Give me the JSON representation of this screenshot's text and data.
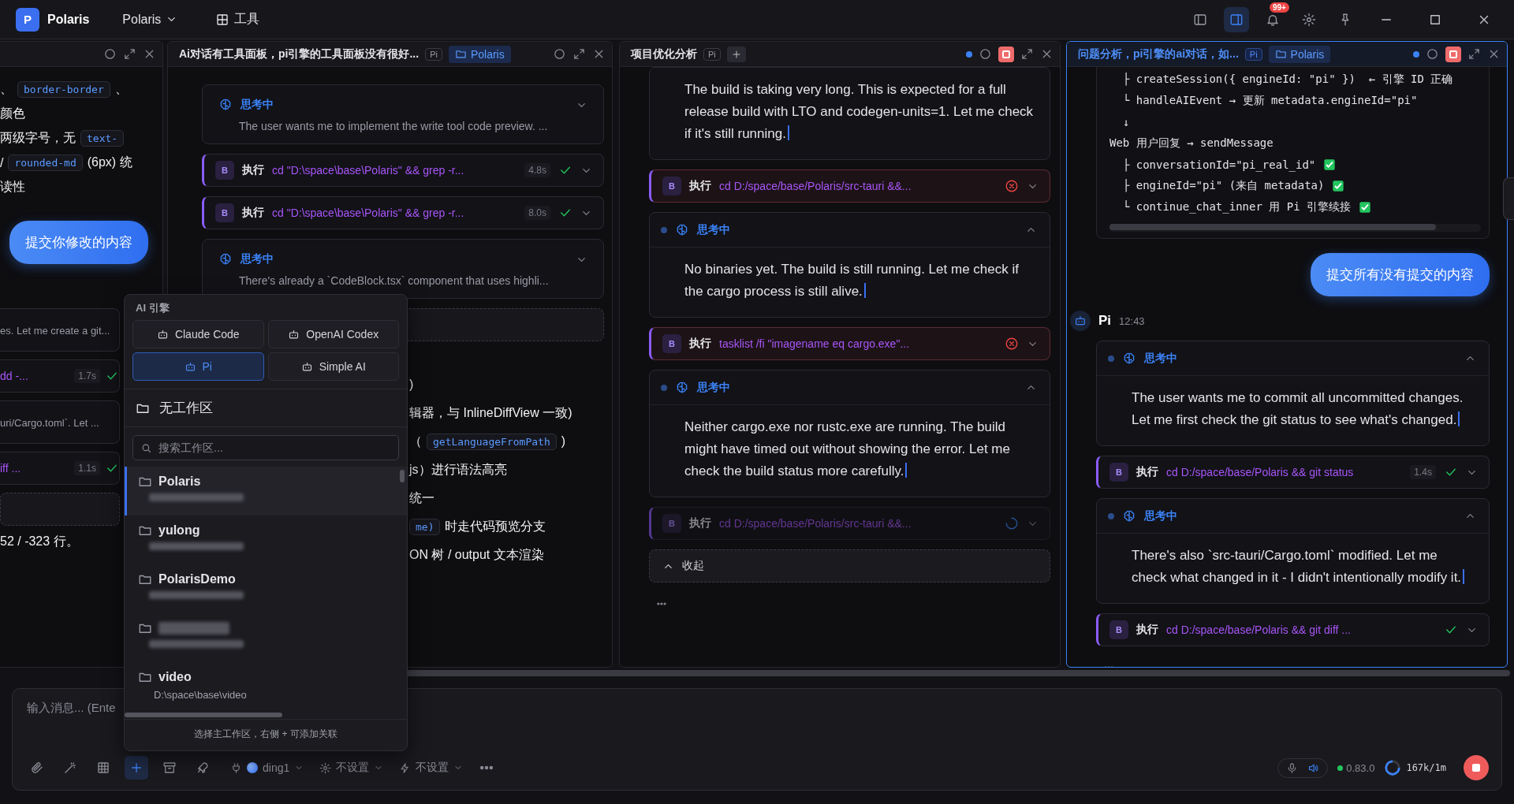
{
  "titlebar": {
    "logo": "P",
    "app_name": "Polaris",
    "project": "Polaris",
    "tools_label": "工具",
    "notification_badge": "99+",
    "layout_toggles": [
      {
        "kind": "left-sidebar",
        "on": false
      },
      {
        "kind": "right-sidebar",
        "on": true
      }
    ]
  },
  "panels": [
    {
      "header": {
        "active": false,
        "running": false
      },
      "blocks": [
        {
          "kind": "text",
          "segments": [
            {
              "kind": "plain",
              "text": "、"
            },
            {
              "kind": "code",
              "text": "border-border"
            },
            {
              "kind": "plain",
              "text": "、"
            }
          ]
        },
        {
          "kind": "text",
          "segments": [
            {
              "kind": "plain",
              "text": "颜色"
            }
          ]
        },
        {
          "kind": "text",
          "segments": [
            {
              "kind": "plain",
              "text": "两级字号，无"
            },
            {
              "kind": "code",
              "text": "text-"
            }
          ]
        },
        {
          "kind": "text",
          "segments": [
            {
              "kind": "plain",
              "text": "/"
            },
            {
              "kind": "code",
              "text": "rounded-md"
            },
            {
              "kind": "plain",
              "text": "(6px) 统"
            }
          ]
        },
        {
          "kind": "text",
          "segments": [
            {
              "kind": "plain",
              "text": "读性"
            }
          ]
        },
        {
          "kind": "user-message",
          "text": "提交你修改的内容"
        },
        {
          "kind": "thinking",
          "text": "es. Let me create a git...",
          "expanded": false,
          "live": false
        },
        {
          "kind": "exec",
          "command": "dd -...",
          "duration": "1.7s",
          "failed": false,
          "running": false
        },
        {
          "kind": "thinking",
          "text": "uri/Cargo.toml`. Let ...",
          "expanded": false,
          "live": false
        },
        {
          "kind": "exec",
          "command": "iff ...",
          "duration": "1.1s",
          "failed": false,
          "running": false
        },
        {
          "kind": "placeholder"
        },
        {
          "kind": "text",
          "segments": [
            {
              "kind": "plain",
              "text": "52 / -323 行。"
            }
          ]
        }
      ]
    },
    {
      "header": {
        "title": "Ai对话有工具面板，pi引擎的工具面板没有很好...",
        "badge": "Pi",
        "chip": "Polaris",
        "active": false,
        "running": false
      },
      "blocks": [
        {
          "kind": "thinking",
          "label": "思考中",
          "text": "The user wants me to implement the write tool code preview. ...",
          "expanded": false,
          "live": false
        },
        {
          "kind": "exec",
          "badge": "B",
          "label": "执行",
          "command": "cd \"D:\\space\\base\\Polaris\" && grep -r...",
          "duration": "4.8s",
          "failed": false,
          "running": false
        },
        {
          "kind": "exec",
          "badge": "B",
          "label": "执行",
          "command": "cd \"D:\\space\\base\\Polaris\" && grep -r...",
          "duration": "8.0s",
          "failed": false,
          "running": false
        },
        {
          "kind": "thinking",
          "label": "思考中",
          "text": "There's already a `CodeBlock.tsx` component that uses highli...",
          "expanded": false,
          "live": false
        },
        {
          "kind": "placeholder"
        },
        {
          "kind": "tail-text",
          "segments": [
            {
              "kind": "plain",
              "text": ")"
            }
          ]
        },
        {
          "kind": "tail-text",
          "segments": [
            {
              "kind": "plain",
              "text": "辑器，与 InlineDiffView 一致)"
            }
          ]
        },
        {
          "kind": "tail-text",
          "segments": [
            {
              "kind": "plain",
              "text": "（"
            },
            {
              "kind": "code",
              "text": "getLanguageFromPath"
            },
            {
              "kind": "plain",
              "text": ")"
            }
          ]
        },
        {
          "kind": "tail-text",
          "segments": [
            {
              "kind": "plain",
              "text": "js）进行语法高亮"
            }
          ]
        },
        {
          "kind": "tail-text",
          "segments": [
            {
              "kind": "plain",
              "text": "统一"
            }
          ]
        },
        {
          "kind": "tail-text",
          "segments": [
            {
              "kind": "code",
              "text": "me)"
            },
            {
              "kind": "plain",
              "text": "时走代码预览分支"
            }
          ]
        },
        {
          "kind": "tail-text",
          "segments": [
            {
              "kind": "plain",
              "text": "ON 树 / output 文本渲染"
            }
          ]
        }
      ]
    },
    {
      "header": {
        "title": "项目优化分析",
        "badge": "Pi",
        "can_add": true,
        "active": false,
        "running": true
      },
      "blocks": [
        {
          "kind": "thinking",
          "text": "The build is taking very long. This is expected for a full release build with LTO and codegen-units=1. Let me check if it's still running.",
          "expanded": true,
          "live": true
        },
        {
          "kind": "exec",
          "badge": "B",
          "label": "执行",
          "command": "cd D:/space/base/Polaris/src-tauri &&...",
          "failed": true,
          "running": false
        },
        {
          "kind": "thinking",
          "label": "思考中",
          "text": "No binaries yet. The build is still running. Let me check if the cargo process is still alive.",
          "expanded": true,
          "live": true
        },
        {
          "kind": "exec",
          "badge": "B",
          "label": "执行",
          "command": "tasklist /fi \"imagename eq cargo.exe\"...",
          "failed": true,
          "running": false
        },
        {
          "kind": "thinking",
          "label": "思考中",
          "text": "Neither cargo.exe nor rustc.exe are running. The build might have timed out without showing the error. Let me check the build status more carefully.",
          "expanded": true,
          "live": true
        },
        {
          "kind": "exec",
          "badge": "B",
          "label": "执行",
          "command": "cd D:/space/base/Polaris/src-tauri &&...",
          "failed": false,
          "running": true
        },
        {
          "kind": "collapse",
          "label": "收起"
        },
        {
          "kind": "typing"
        }
      ]
    },
    {
      "header": {
        "title": "问题分析，pi引擎的ai对话，如...",
        "badge": "Pi",
        "chip": "Polaris",
        "active": true,
        "running": true
      },
      "blocks": [
        {
          "kind": "code",
          "lines": [
            {
              "text": "  ├ createSession({ engineId: \"pi\" })  ← 引擎 ID 正确",
              "check": false
            },
            {
              "text": "  └ handleAIEvent → 更新 metadata.engineId=\"pi\"",
              "check": false
            },
            {
              "text": "  ↓",
              "check": false
            },
            {
              "text": "Web 用户回复 → sendMessage",
              "check": false
            },
            {
              "text": "  ├ conversationId=\"pi_real_id\"",
              "check": true
            },
            {
              "text": "  ├ engineId=\"pi\" (来自 metadata)",
              "check": true
            },
            {
              "text": "  └ continue_chat_inner 用 Pi 引擎续接",
              "check": true
            }
          ]
        },
        {
          "kind": "user-message",
          "text": "提交所有没有提交的内容"
        },
        {
          "kind": "assistant",
          "name": "Pi",
          "time": "12:43"
        },
        {
          "kind": "thinking",
          "label": "思考中",
          "text": "The user wants me to commit all uncommitted changes. Let me first check the git status to see what's changed.",
          "expanded": true,
          "live": true
        },
        {
          "kind": "exec",
          "badge": "B",
          "label": "执行",
          "command": "cd D:/space/base/Polaris && git status",
          "duration": "1.4s",
          "failed": false,
          "running": false
        },
        {
          "kind": "thinking",
          "label": "思考中",
          "text": "There's also `src-tauri/Cargo.toml` modified. Let me check what changed in it - I didn't intentionally modify it.",
          "expanded": true,
          "live": true
        },
        {
          "kind": "exec",
          "badge": "B",
          "label": "执行",
          "command": "cd D:/space/base/Polaris && git diff ...",
          "failed": false,
          "running": false
        },
        {
          "kind": "typing"
        }
      ]
    }
  ],
  "engine_picker": {
    "title": "AI 引擎",
    "engines": [
      {
        "label": "Claude Code",
        "selected": false
      },
      {
        "label": "OpenAI Codex",
        "selected": false
      },
      {
        "label": "Pi",
        "selected": true
      },
      {
        "label": "Simple AI",
        "selected": false
      }
    ],
    "no_workspace": "无工作区",
    "search_placeholder": "搜索工作区...",
    "workspaces": [
      {
        "name": "Polaris",
        "path_hidden": true,
        "selected": true
      },
      {
        "name": "yulong",
        "path_hidden": true,
        "selected": false
      },
      {
        "name": "PolarisDemo",
        "path_hidden": true,
        "selected": false
      },
      {
        "name_hidden": true,
        "path_hidden": true,
        "selected": false
      },
      {
        "name": "video",
        "path": "D:\\space\\base\\video",
        "selected": false
      }
    ],
    "footer": "选择主工作区，右侧 + 可添加关联"
  },
  "composer": {
    "placeholder": "输入消息... (Ente",
    "tools": [
      {
        "kind": "attach",
        "active": false
      },
      {
        "kind": "wand",
        "active": false
      },
      {
        "kind": "table",
        "active": false
      },
      {
        "kind": "plus",
        "active": true
      },
      {
        "kind": "archive",
        "active": false
      },
      {
        "kind": "rocket",
        "active": false
      }
    ],
    "selects": [
      {
        "kind": "model",
        "label": "ding1"
      },
      {
        "kind": "settings",
        "label": "不设置"
      },
      {
        "kind": "mode",
        "label": "不设置"
      }
    ],
    "version": "0.83.0",
    "context": "167k/1m"
  }
}
